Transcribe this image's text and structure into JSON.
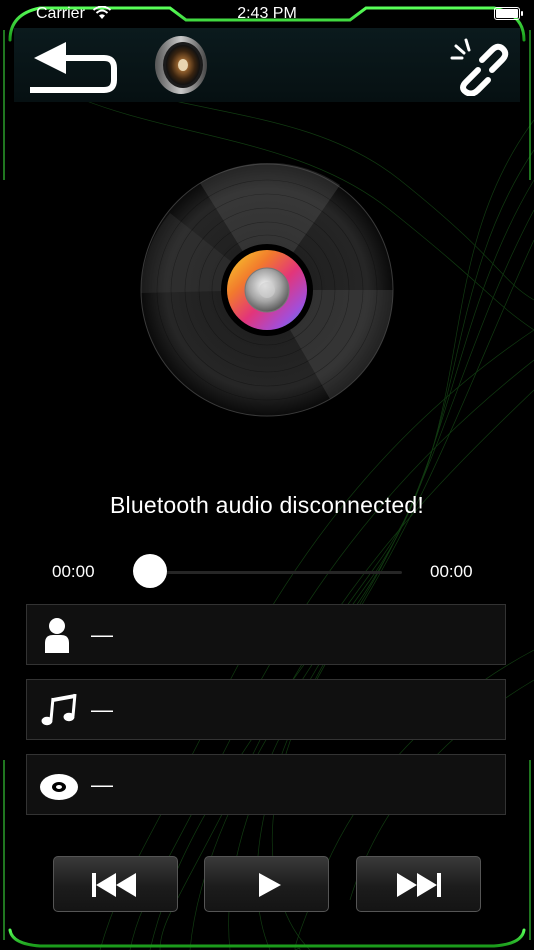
{
  "status_bar": {
    "carrier": "Carrier",
    "time": "2:43 PM"
  },
  "header": {
    "back_icon": "back-arrow-icon",
    "speaker_icon": "speaker-icon",
    "link_icon": "broken-link-icon"
  },
  "player": {
    "status_message": "Bluetooth audio disconnected!",
    "time_current": "00:00",
    "time_total": "00:00",
    "progress": 0
  },
  "track_info": {
    "artist": {
      "icon": "person-icon",
      "value": "—"
    },
    "title": {
      "icon": "music-note-icon",
      "value": "—"
    },
    "album": {
      "icon": "disc-icon",
      "value": "—"
    }
  },
  "controls": {
    "previous_icon": "previous-track-icon",
    "play_icon": "play-icon",
    "next_icon": "next-track-icon"
  },
  "colors": {
    "background": "#000000",
    "frame_accent": "#2fd02f",
    "text": "#ffffff"
  }
}
